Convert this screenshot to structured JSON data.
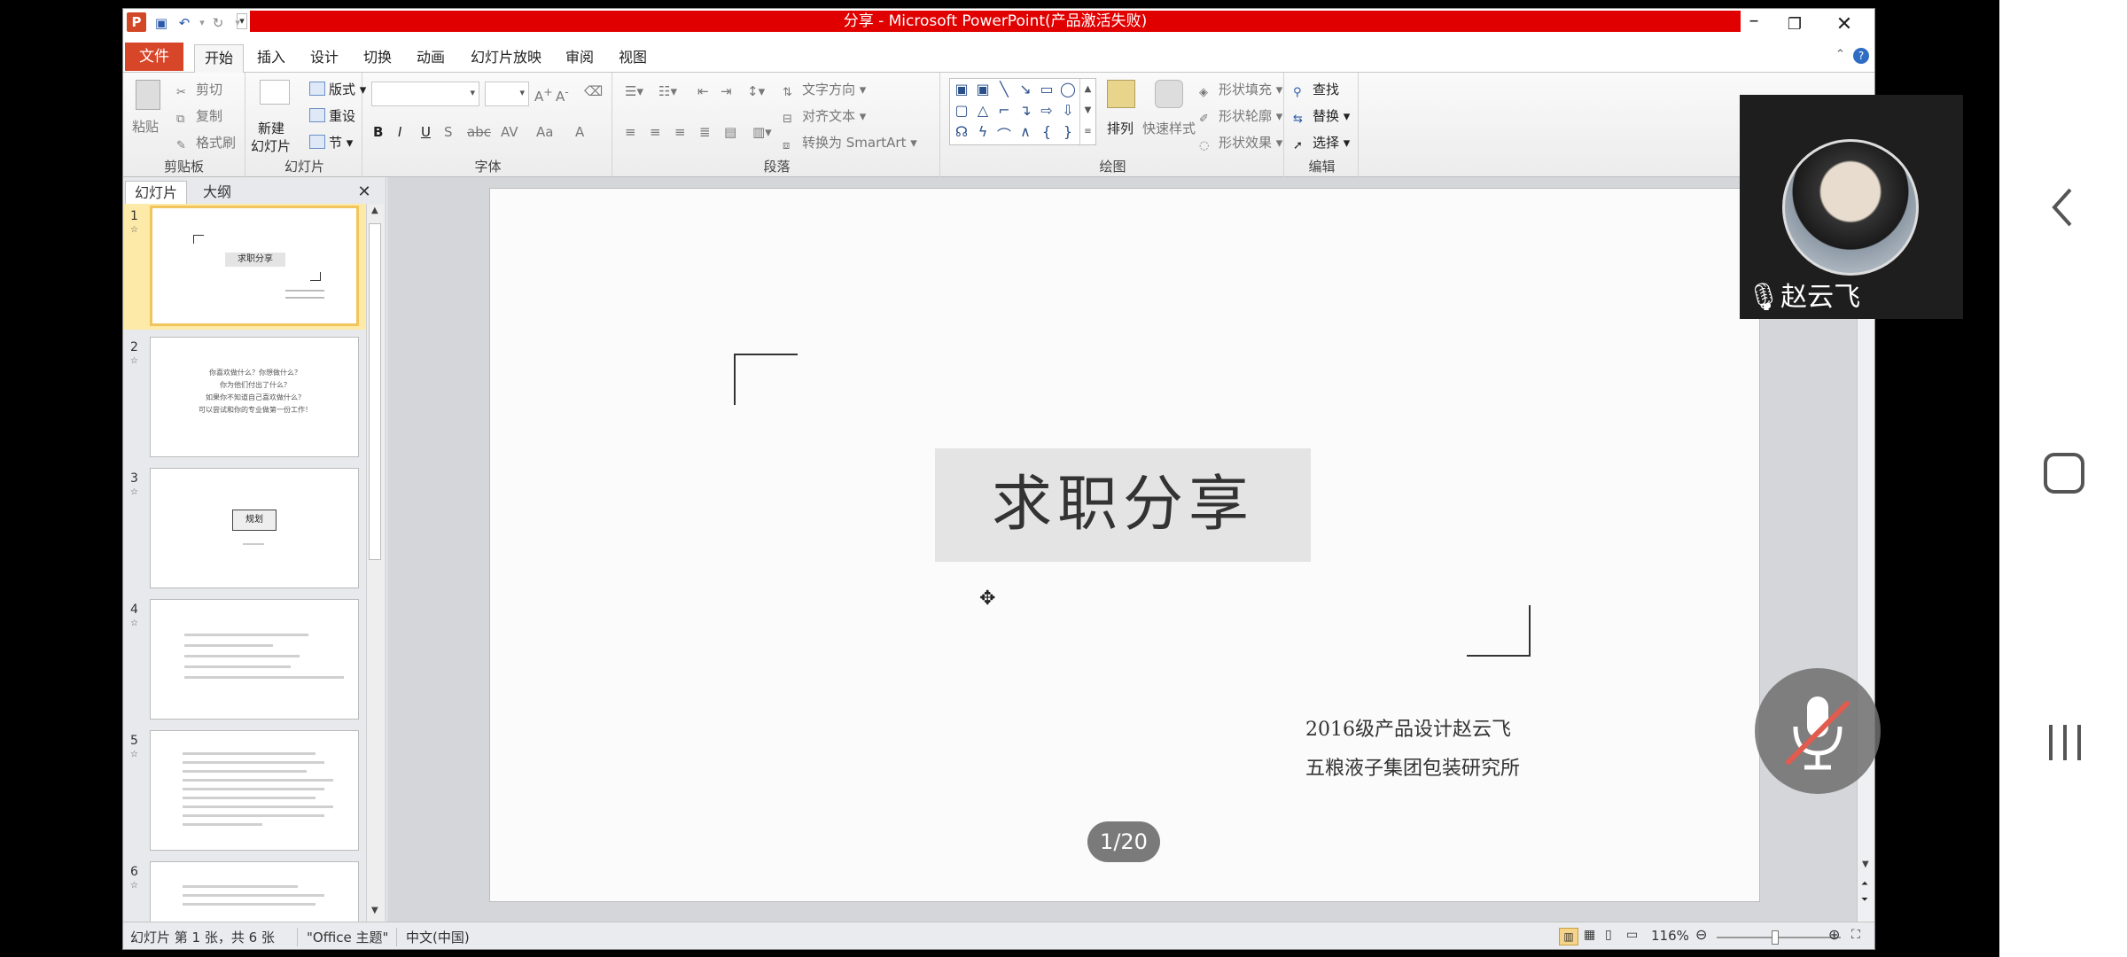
{
  "window": {
    "title": "分享 - Microsoft PowerPoint(产品激活失败)"
  },
  "ribbon_tabs": [
    "文件",
    "开始",
    "插入",
    "设计",
    "切换",
    "动画",
    "幻灯片放映",
    "审阅",
    "视图"
  ],
  "ribbon": {
    "clipboard": {
      "paste": "粘贴",
      "cut": "剪切",
      "copy": "复制",
      "format_painter": "格式刷",
      "label": "剪贴板"
    },
    "slides": {
      "new_slide_1": "新建",
      "new_slide_2": "幻灯片",
      "layout": "版式",
      "reset": "重设",
      "section": "节",
      "label": "幻灯片"
    },
    "font": {
      "label": "字体"
    },
    "paragraph": {
      "text_direction": "文字方向",
      "align_text": "对齐文本",
      "convert_smartart": "转换为 SmartArt",
      "label": "段落"
    },
    "drawing": {
      "arrange": "排列",
      "quick_styles": "快速样式",
      "shape_fill": "形状填充",
      "shape_outline": "形状轮廓",
      "shape_effects": "形状效果",
      "label": "绘图"
    },
    "editing": {
      "find": "查找",
      "replace": "替换",
      "select": "选择",
      "label": "编辑"
    }
  },
  "left_panel": {
    "tabs": [
      "幻灯片",
      "大纲"
    ],
    "thumbs": [
      {
        "num": "1",
        "lines": [
          "求职分享"
        ]
      },
      {
        "num": "2",
        "lines": [
          "你喜欢做什么？你想做什么？",
          "你为他们付出了什么？",
          "如果你不知道自己喜欢做什么？",
          "可以尝试和你的专业做第一份工作！"
        ]
      },
      {
        "num": "3",
        "lines": [
          "规划"
        ]
      },
      {
        "num": "4",
        "lines": []
      },
      {
        "num": "5",
        "lines": []
      },
      {
        "num": "6",
        "lines": []
      }
    ]
  },
  "slide": {
    "title": "求职分享",
    "subtitle_line1": "2016级产品设计赵云飞",
    "subtitle_line2": "五粮液子集团包装研究所",
    "page_indicator": "1/20"
  },
  "status": {
    "slide_info": "幻灯片 第 1 张，共 6 张",
    "theme": "\"Office 主题\"",
    "language": "中文(中国)",
    "zoom": "116%"
  },
  "video": {
    "participant_name": "赵云飞"
  }
}
